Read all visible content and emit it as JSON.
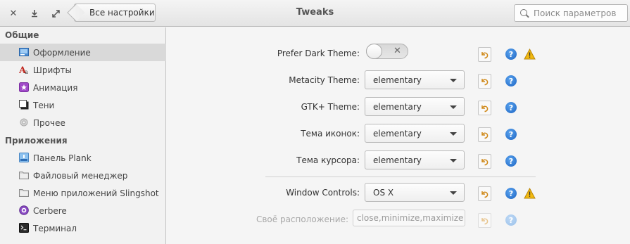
{
  "titlebar": {
    "close_icon": "close-icon",
    "download_icon": "download-icon",
    "maximize_icon": "maximize-icon",
    "back_label": "Все настройки",
    "title": "Tweaks",
    "search_placeholder": "Поиск параметров"
  },
  "sidebar": {
    "section_general": "Общие",
    "section_apps": "Приложения",
    "items": [
      {
        "label": "Оформление",
        "icon": "appearance-icon"
      },
      {
        "label": "Шрифты",
        "icon": "fonts-icon"
      },
      {
        "label": "Анимация",
        "icon": "animation-icon"
      },
      {
        "label": "Тени",
        "icon": "shadows-icon"
      },
      {
        "label": "Прочее",
        "icon": "misc-icon"
      },
      {
        "label": "Панель Plank",
        "icon": "plank-icon"
      },
      {
        "label": "Файловый менеджер",
        "icon": "folder-icon"
      },
      {
        "label": "Меню приложений Slingshot",
        "icon": "folder-icon"
      },
      {
        "label": "Cerbere",
        "icon": "cerbere-icon"
      },
      {
        "label": "Терминал",
        "icon": "terminal-icon"
      }
    ],
    "selected": "Оформление"
  },
  "settings": {
    "dark_theme_label": "Prefer Dark Theme:",
    "dark_theme_on": false,
    "metacity_label": "Metacity Theme:",
    "metacity_value": "elementary",
    "gtk_label": "GTK+ Theme:",
    "gtk_value": "elementary",
    "icons_label": "Тема иконок:",
    "icons_value": "elementary",
    "cursor_label": "Тема курсора:",
    "cursor_value": "elementary",
    "window_controls_label": "Window Controls:",
    "window_controls_value": "OS X",
    "custom_layout_label": "Своё расположение:",
    "custom_layout_value": "close,minimize,maximize"
  },
  "colors": {
    "help_blue": "#1c64c3",
    "warning_yellow": "#f2b90f",
    "reset_orange": "#d08a1c"
  }
}
